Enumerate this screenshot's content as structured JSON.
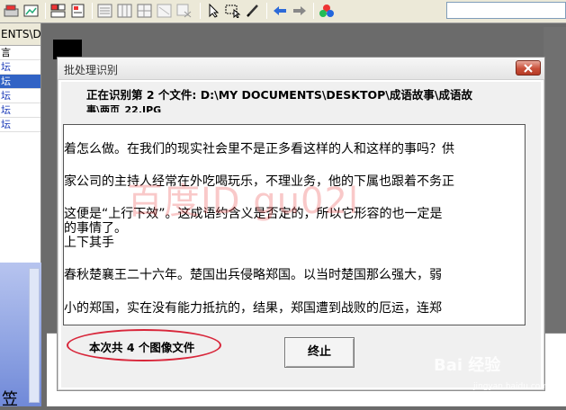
{
  "left_panel": {
    "header": "ENTS\\D",
    "rows": [
      {
        "label": "言",
        "style": "black"
      },
      {
        "label": "坛",
        "style": "blue"
      },
      {
        "label": "坛",
        "style": "selected"
      },
      {
        "label": "坛",
        "style": "blue"
      },
      {
        "label": "坛",
        "style": "blue"
      },
      {
        "label": "坛",
        "style": "blue"
      }
    ],
    "bottom_glyph": "笠"
  },
  "dialog": {
    "title": "批处理识别",
    "status_line": "正在识别第 2 个文件:  D:\\MY DOCUMENTS\\DESKTOP\\成语故事\\成语故",
    "status_line_2": "事\\两页_22.JPG",
    "text_lines": [
      "着怎么做。在我们的现实社会里不是正多看这样的人和这样的事吗？供",
      "家公司的主持人经常在外吃喝玩乐，不理业务，他的下属也跟着不务正",
      "这便是“上行下效”。这成语约含义是否定的，所以它形容的也一定是",
      "的事情了。",
      "上下其手",
      " 春秋楚襄王二十六年。楚国出兵侵略郑国。以当时楚国那么强大，弱",
      "小的郑国，实在没有能力抵抗的，结果，郑国遭到战败的厄运，连郑"
    ],
    "count_label": "本次共 4 个图像文件",
    "stop_button": "终止"
  },
  "watermark": "百度ID gu02l",
  "baidu_logo": "Bai  经验",
  "baidu_sub": "jingyan.baidu.com",
  "colors": {
    "selection": "#3163c5",
    "oval": "#d8263a",
    "close_button": "#c9503a"
  }
}
